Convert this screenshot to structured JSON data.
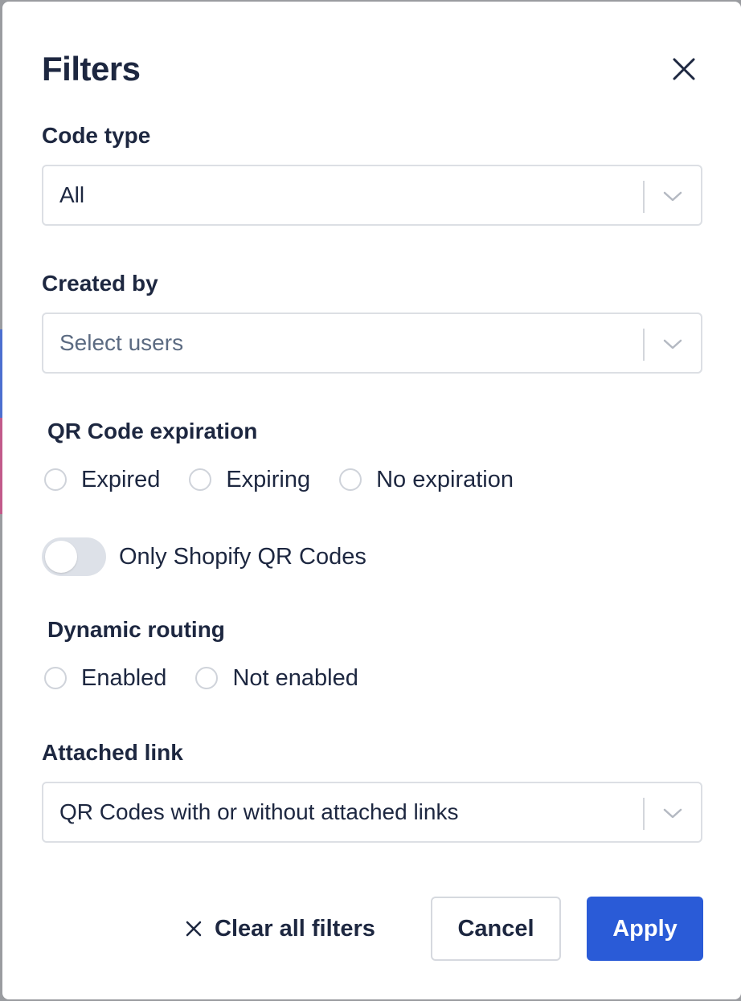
{
  "modal": {
    "title": "Filters",
    "close_icon": "close-icon"
  },
  "code_type": {
    "label": "Code type",
    "value": "All",
    "icon": "chevron-down-icon"
  },
  "created_by": {
    "label": "Created by",
    "placeholder": "Select users",
    "icon": "chevron-down-icon"
  },
  "expiration": {
    "label": "QR Code expiration",
    "options": [
      "Expired",
      "Expiring",
      "No expiration"
    ]
  },
  "shopify_toggle": {
    "label": "Only Shopify QR Codes",
    "enabled": false
  },
  "dynamic_routing": {
    "label": "Dynamic routing",
    "options": [
      "Enabled",
      "Not enabled"
    ]
  },
  "attached_link": {
    "label": "Attached link",
    "value": "QR Codes with or without attached links",
    "icon": "chevron-down-icon"
  },
  "footer": {
    "clear_label": "Clear all filters",
    "cancel_label": "Cancel",
    "apply_label": "Apply"
  },
  "colors": {
    "primary": "#2a5bd7",
    "text": "#1d2740",
    "border": "#dcdfe4",
    "toggle_off": "#dde1e8"
  }
}
